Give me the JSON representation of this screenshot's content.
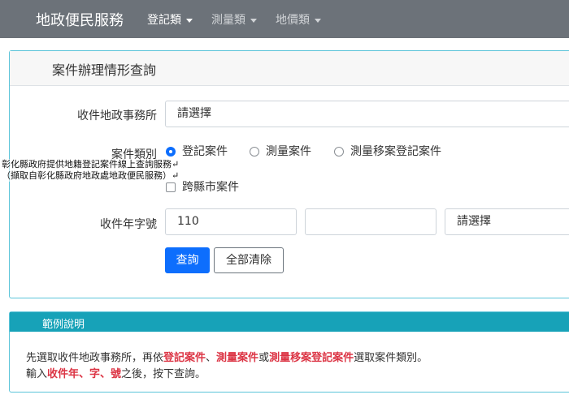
{
  "navbar": {
    "brand": "地政便民服務",
    "items": [
      {
        "label": "登記類",
        "active": true
      },
      {
        "label": "測量類",
        "active": false
      },
      {
        "label": "地價類",
        "active": false
      }
    ]
  },
  "form": {
    "header_title": "案件辦理情形查詢",
    "office_label": "收件地政事務所",
    "office_value": "請選擇",
    "type_label": "案件類別",
    "type_options": [
      "登記案件",
      "測量案件",
      "測量移案登記案件"
    ],
    "cross_county_label": "跨縣市案件",
    "number_label": "收件年字號",
    "year_value": "110",
    "char_value": "",
    "select_value": "請選擇",
    "query_button": "查詢",
    "clear_button": "全部清除"
  },
  "overlay": {
    "line1": "彰化縣政府提供地籍登記案件線上查詢服務↵",
    "line2": "（擷取自彰化縣政府地政處地政便民服務）↵"
  },
  "example": {
    "title": "範例說明",
    "line1_parts": [
      "先選取收件地政事務所，再依",
      "登記案件",
      "、",
      "測量案件",
      "或",
      "測量移案登記案件",
      "選取案件類別。"
    ],
    "line2_parts": [
      "輸入",
      "收件年、字、號",
      "之後，按下查詢。"
    ]
  }
}
